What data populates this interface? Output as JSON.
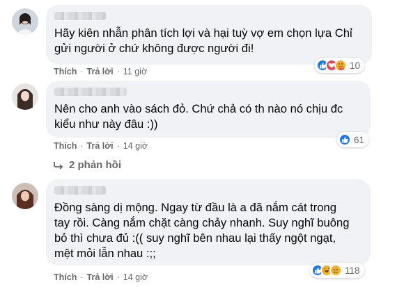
{
  "comments": [
    {
      "text": "Hãy kiên nhẫn phân tích lợi và hại tuỳ vợ em chọn lựa Chỉ\ngửi người ở chứ không được người đi!",
      "like_label": "Thích",
      "reply_label": "Trả lời",
      "time": "11 giờ",
      "reaction_count": "10",
      "reactions": [
        "like-icon",
        "love-icon",
        "care-icon"
      ]
    },
    {
      "text": "Nên cho anh vào sách đỏ. Chứ chả có th nào nó chịu đc\nkiểu như này đâu :))",
      "like_label": "Thích",
      "reply_label": "Trả lời",
      "time": "14 giờ",
      "reaction_count": "61",
      "reactions": [
        "like-icon"
      ],
      "replies_label": "2 phản hồi"
    },
    {
      "text": "Đồng sàng dị mộng. Ngay từ đầu là a đã nắm cát trong\ntay rồi. Càng nắm chặt càng chảy nhanh. Suy nghĩ buông\nbỏ thì chưa đủ :(( suy nghĩ bên nhau lại thấy ngột ngạt,\nmệt mỏi lẫn nhau :;;",
      "like_label": "Thích",
      "reply_label": "Trả lời",
      "time": "14 giờ",
      "reaction_count": "118",
      "reactions": [
        "like-icon",
        "haha-icon",
        "sad-icon"
      ]
    }
  ],
  "colors": {
    "bubble": "#f0f2f5",
    "meta": "#65676b",
    "like": "#1877f2",
    "love": "#f33e58",
    "yellow": "#f7b125"
  }
}
